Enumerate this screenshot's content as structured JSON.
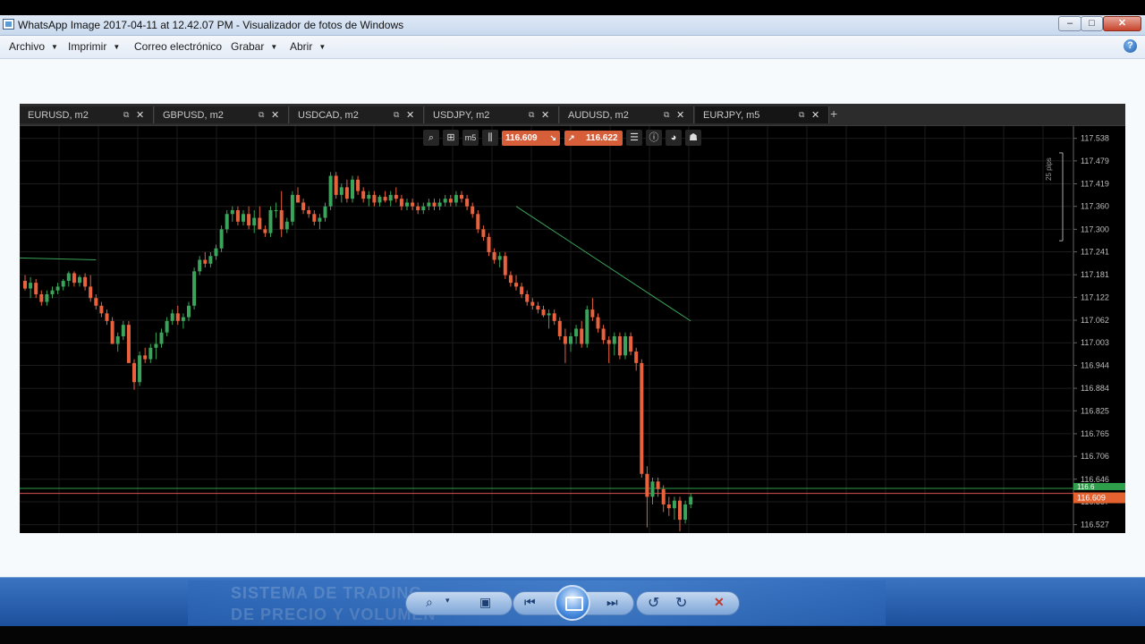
{
  "window": {
    "title": "WhatsApp Image 2017-04-11 at 12.42.07 PM - Visualizador de fotos de Windows",
    "minimize_label": "–",
    "maximize_label": "□",
    "close_label": "✕"
  },
  "menu": {
    "items": [
      {
        "label": "Archivo",
        "has_dropdown": true
      },
      {
        "label": "Imprimir",
        "has_dropdown": true
      },
      {
        "label": "Correo electrónico",
        "has_dropdown": false
      },
      {
        "label": "Grabar",
        "has_dropdown": true
      },
      {
        "label": "Abrir",
        "has_dropdown": true
      }
    ],
    "help_icon": "?"
  },
  "trading_screenshot": {
    "tabs": [
      {
        "label": "EURUSD, m2",
        "active": false
      },
      {
        "label": "GBPUSD, m2",
        "active": false
      },
      {
        "label": "USDCAD, m2",
        "active": false
      },
      {
        "label": "USDJPY, m2",
        "active": false
      },
      {
        "label": "AUDUSD, m2",
        "active": false
      },
      {
        "label": "EURJPY, m5",
        "active": true
      }
    ],
    "add_tab": "+",
    "toolbar": {
      "sell_price": "116.609",
      "buy_price": "116.622",
      "timeframe_label": "m5"
    },
    "pips_label": "25 pips",
    "current_price_label": "116.609",
    "green_tag_label": "116.6",
    "colors": {
      "bull": "#3aa55a",
      "bear": "#e8623e",
      "bid_line": "#d9534f",
      "ask_line": "#2e9e4a"
    }
  },
  "chart_data": {
    "type": "candlestick",
    "symbol": "EURJPY",
    "timeframe": "m5",
    "y_ticks": [
      "117.538",
      "117.479",
      "117.419",
      "117.360",
      "117.300",
      "117.241",
      "117.181",
      "117.122",
      "117.062",
      "117.003",
      "116.944",
      "116.884",
      "116.825",
      "116.765",
      "116.706",
      "116.646",
      "116.587",
      "116.527"
    ],
    "ylim": [
      116.505,
      117.57
    ],
    "bid": 116.609,
    "ask": 116.622,
    "candles": [
      {
        "o": 117.165,
        "h": 117.18,
        "l": 117.14,
        "c": 117.145
      },
      {
        "o": 117.145,
        "h": 117.175,
        "l": 117.12,
        "c": 117.16
      },
      {
        "o": 117.16,
        "h": 117.17,
        "l": 117.12,
        "c": 117.13
      },
      {
        "o": 117.13,
        "h": 117.14,
        "l": 117.1,
        "c": 117.11
      },
      {
        "o": 117.11,
        "h": 117.14,
        "l": 117.1,
        "c": 117.13
      },
      {
        "o": 117.13,
        "h": 117.15,
        "l": 117.12,
        "c": 117.14
      },
      {
        "o": 117.14,
        "h": 117.16,
        "l": 117.13,
        "c": 117.15
      },
      {
        "o": 117.15,
        "h": 117.17,
        "l": 117.14,
        "c": 117.165
      },
      {
        "o": 117.165,
        "h": 117.19,
        "l": 117.15,
        "c": 117.185
      },
      {
        "o": 117.185,
        "h": 117.19,
        "l": 117.15,
        "c": 117.16
      },
      {
        "o": 117.16,
        "h": 117.18,
        "l": 117.15,
        "c": 117.175
      },
      {
        "o": 117.175,
        "h": 117.185,
        "l": 117.14,
        "c": 117.15
      },
      {
        "o": 117.15,
        "h": 117.18,
        "l": 117.11,
        "c": 117.12
      },
      {
        "o": 117.12,
        "h": 117.13,
        "l": 117.09,
        "c": 117.1
      },
      {
        "o": 117.1,
        "h": 117.11,
        "l": 117.07,
        "c": 117.08
      },
      {
        "o": 117.08,
        "h": 117.09,
        "l": 117.05,
        "c": 117.06
      },
      {
        "o": 117.06,
        "h": 117.07,
        "l": 117.0,
        "c": 117.0
      },
      {
        "o": 117.0,
        "h": 117.03,
        "l": 116.98,
        "c": 117.02
      },
      {
        "o": 117.02,
        "h": 117.06,
        "l": 117.01,
        "c": 117.05
      },
      {
        "o": 117.05,
        "h": 117.06,
        "l": 116.96,
        "c": 116.95
      },
      {
        "o": 116.95,
        "h": 116.96,
        "l": 116.88,
        "c": 116.9
      },
      {
        "o": 116.9,
        "h": 116.98,
        "l": 116.89,
        "c": 116.97
      },
      {
        "o": 116.97,
        "h": 116.99,
        "l": 116.95,
        "c": 116.96
      },
      {
        "o": 116.96,
        "h": 117.0,
        "l": 116.95,
        "c": 116.99
      },
      {
        "o": 116.99,
        "h": 117.03,
        "l": 116.96,
        "c": 117.0
      },
      {
        "o": 117.0,
        "h": 117.04,
        "l": 116.99,
        "c": 117.03
      },
      {
        "o": 117.03,
        "h": 117.07,
        "l": 117.02,
        "c": 117.06
      },
      {
        "o": 117.06,
        "h": 117.09,
        "l": 117.05,
        "c": 117.08
      },
      {
        "o": 117.08,
        "h": 117.1,
        "l": 117.05,
        "c": 117.06
      },
      {
        "o": 117.06,
        "h": 117.08,
        "l": 117.04,
        "c": 117.07
      },
      {
        "o": 117.07,
        "h": 117.11,
        "l": 117.06,
        "c": 117.1
      },
      {
        "o": 117.1,
        "h": 117.2,
        "l": 117.09,
        "c": 117.19
      },
      {
        "o": 117.19,
        "h": 117.23,
        "l": 117.18,
        "c": 117.22
      },
      {
        "o": 117.22,
        "h": 117.24,
        "l": 117.2,
        "c": 117.21
      },
      {
        "o": 117.21,
        "h": 117.24,
        "l": 117.2,
        "c": 117.23
      },
      {
        "o": 117.23,
        "h": 117.26,
        "l": 117.22,
        "c": 117.25
      },
      {
        "o": 117.25,
        "h": 117.31,
        "l": 117.24,
        "c": 117.3
      },
      {
        "o": 117.3,
        "h": 117.35,
        "l": 117.29,
        "c": 117.34
      },
      {
        "o": 117.34,
        "h": 117.36,
        "l": 117.32,
        "c": 117.35
      },
      {
        "o": 117.35,
        "h": 117.36,
        "l": 117.31,
        "c": 117.32
      },
      {
        "o": 117.32,
        "h": 117.35,
        "l": 117.31,
        "c": 117.34
      },
      {
        "o": 117.34,
        "h": 117.36,
        "l": 117.3,
        "c": 117.31
      },
      {
        "o": 117.31,
        "h": 117.35,
        "l": 117.29,
        "c": 117.33
      },
      {
        "o": 117.33,
        "h": 117.36,
        "l": 117.3,
        "c": 117.3
      },
      {
        "o": 117.3,
        "h": 117.31,
        "l": 117.28,
        "c": 117.29
      },
      {
        "o": 117.29,
        "h": 117.36,
        "l": 117.28,
        "c": 117.35
      },
      {
        "o": 117.35,
        "h": 117.37,
        "l": 117.33,
        "c": 117.35
      },
      {
        "o": 117.35,
        "h": 117.4,
        "l": 117.28,
        "c": 117.3
      },
      {
        "o": 117.3,
        "h": 117.33,
        "l": 117.29,
        "c": 117.32
      },
      {
        "o": 117.32,
        "h": 117.4,
        "l": 117.31,
        "c": 117.39
      },
      {
        "o": 117.39,
        "h": 117.41,
        "l": 117.37,
        "c": 117.37
      },
      {
        "o": 117.37,
        "h": 117.38,
        "l": 117.34,
        "c": 117.35
      },
      {
        "o": 117.35,
        "h": 117.36,
        "l": 117.33,
        "c": 117.34
      },
      {
        "o": 117.34,
        "h": 117.35,
        "l": 117.31,
        "c": 117.32
      },
      {
        "o": 117.32,
        "h": 117.34,
        "l": 117.3,
        "c": 117.33
      },
      {
        "o": 117.33,
        "h": 117.37,
        "l": 117.32,
        "c": 117.36
      },
      {
        "o": 117.36,
        "h": 117.45,
        "l": 117.35,
        "c": 117.44
      },
      {
        "o": 117.44,
        "h": 117.45,
        "l": 117.38,
        "c": 117.39
      },
      {
        "o": 117.39,
        "h": 117.42,
        "l": 117.37,
        "c": 117.41
      },
      {
        "o": 117.41,
        "h": 117.43,
        "l": 117.37,
        "c": 117.38
      },
      {
        "o": 117.38,
        "h": 117.44,
        "l": 117.37,
        "c": 117.43
      },
      {
        "o": 117.43,
        "h": 117.44,
        "l": 117.39,
        "c": 117.4
      },
      {
        "o": 117.4,
        "h": 117.41,
        "l": 117.37,
        "c": 117.38
      },
      {
        "o": 117.38,
        "h": 117.4,
        "l": 117.36,
        "c": 117.39
      },
      {
        "o": 117.39,
        "h": 117.4,
        "l": 117.36,
        "c": 117.37
      },
      {
        "o": 117.37,
        "h": 117.39,
        "l": 117.36,
        "c": 117.385
      },
      {
        "o": 117.385,
        "h": 117.4,
        "l": 117.37,
        "c": 117.375
      },
      {
        "o": 117.375,
        "h": 117.4,
        "l": 117.36,
        "c": 117.39
      },
      {
        "o": 117.39,
        "h": 117.41,
        "l": 117.37,
        "c": 117.38
      },
      {
        "o": 117.38,
        "h": 117.39,
        "l": 117.35,
        "c": 117.36
      },
      {
        "o": 117.36,
        "h": 117.38,
        "l": 117.35,
        "c": 117.37
      },
      {
        "o": 117.37,
        "h": 117.38,
        "l": 117.35,
        "c": 117.36
      },
      {
        "o": 117.36,
        "h": 117.37,
        "l": 117.34,
        "c": 117.35
      },
      {
        "o": 117.35,
        "h": 117.37,
        "l": 117.34,
        "c": 117.36
      },
      {
        "o": 117.36,
        "h": 117.38,
        "l": 117.35,
        "c": 117.37
      },
      {
        "o": 117.37,
        "h": 117.38,
        "l": 117.35,
        "c": 117.36
      },
      {
        "o": 117.36,
        "h": 117.38,
        "l": 117.35,
        "c": 117.37
      },
      {
        "o": 117.37,
        "h": 117.39,
        "l": 117.36,
        "c": 117.38
      },
      {
        "o": 117.38,
        "h": 117.39,
        "l": 117.36,
        "c": 117.37
      },
      {
        "o": 117.37,
        "h": 117.4,
        "l": 117.36,
        "c": 117.39
      },
      {
        "o": 117.39,
        "h": 117.4,
        "l": 117.37,
        "c": 117.38
      },
      {
        "o": 117.38,
        "h": 117.39,
        "l": 117.35,
        "c": 117.36
      },
      {
        "o": 117.36,
        "h": 117.37,
        "l": 117.33,
        "c": 117.34
      },
      {
        "o": 117.34,
        "h": 117.35,
        "l": 117.29,
        "c": 117.3
      },
      {
        "o": 117.3,
        "h": 117.31,
        "l": 117.27,
        "c": 117.28
      },
      {
        "o": 117.28,
        "h": 117.29,
        "l": 117.23,
        "c": 117.24
      },
      {
        "o": 117.24,
        "h": 117.25,
        "l": 117.21,
        "c": 117.22
      },
      {
        "o": 117.22,
        "h": 117.24,
        "l": 117.2,
        "c": 117.23
      },
      {
        "o": 117.23,
        "h": 117.24,
        "l": 117.17,
        "c": 117.18
      },
      {
        "o": 117.18,
        "h": 117.19,
        "l": 117.15,
        "c": 117.16
      },
      {
        "o": 117.16,
        "h": 117.18,
        "l": 117.14,
        "c": 117.15
      },
      {
        "o": 117.15,
        "h": 117.16,
        "l": 117.12,
        "c": 117.13
      },
      {
        "o": 117.13,
        "h": 117.14,
        "l": 117.1,
        "c": 117.11
      },
      {
        "o": 117.11,
        "h": 117.12,
        "l": 117.09,
        "c": 117.1
      },
      {
        "o": 117.1,
        "h": 117.11,
        "l": 117.08,
        "c": 117.09
      },
      {
        "o": 117.09,
        "h": 117.1,
        "l": 117.07,
        "c": 117.075
      },
      {
        "o": 117.075,
        "h": 117.09,
        "l": 117.04,
        "c": 117.08
      },
      {
        "o": 117.08,
        "h": 117.09,
        "l": 117.05,
        "c": 117.06
      },
      {
        "o": 117.06,
        "h": 117.07,
        "l": 117.01,
        "c": 117.02
      },
      {
        "o": 117.02,
        "h": 117.04,
        "l": 116.95,
        "c": 117.0
      },
      {
        "o": 117.0,
        "h": 117.03,
        "l": 116.98,
        "c": 117.02
      },
      {
        "o": 117.02,
        "h": 117.05,
        "l": 117.0,
        "c": 117.04
      },
      {
        "o": 117.04,
        "h": 117.06,
        "l": 116.99,
        "c": 117.0
      },
      {
        "o": 117.0,
        "h": 117.1,
        "l": 116.99,
        "c": 117.09
      },
      {
        "o": 117.09,
        "h": 117.12,
        "l": 117.06,
        "c": 117.07
      },
      {
        "o": 117.07,
        "h": 117.08,
        "l": 117.03,
        "c": 117.04
      },
      {
        "o": 117.04,
        "h": 117.05,
        "l": 117.0,
        "c": 117.01
      },
      {
        "o": 117.01,
        "h": 117.02,
        "l": 116.95,
        "c": 117.0
      },
      {
        "o": 117.0,
        "h": 117.03,
        "l": 116.97,
        "c": 117.02
      },
      {
        "o": 117.02,
        "h": 117.03,
        "l": 116.96,
        "c": 116.97
      },
      {
        "o": 116.97,
        "h": 117.03,
        "l": 116.96,
        "c": 117.02
      },
      {
        "o": 117.02,
        "h": 117.03,
        "l": 116.97,
        "c": 116.98
      },
      {
        "o": 116.98,
        "h": 116.99,
        "l": 116.93,
        "c": 116.95
      },
      {
        "o": 116.95,
        "h": 116.96,
        "l": 116.65,
        "c": 116.66
      },
      {
        "o": 116.66,
        "h": 116.68,
        "l": 116.52,
        "c": 116.6
      },
      {
        "o": 116.6,
        "h": 116.65,
        "l": 116.58,
        "c": 116.64
      },
      {
        "o": 116.64,
        "h": 116.65,
        "l": 116.6,
        "c": 116.62
      },
      {
        "o": 116.62,
        "h": 116.63,
        "l": 116.56,
        "c": 116.58
      },
      {
        "o": 116.58,
        "h": 116.6,
        "l": 116.55,
        "c": 116.57
      },
      {
        "o": 116.57,
        "h": 116.6,
        "l": 116.54,
        "c": 116.59
      },
      {
        "o": 116.59,
        "h": 116.6,
        "l": 116.51,
        "c": 116.54
      },
      {
        "o": 116.54,
        "h": 116.59,
        "l": 116.53,
        "c": 116.58
      },
      {
        "o": 116.58,
        "h": 116.61,
        "l": 116.57,
        "c": 116.6
      }
    ]
  },
  "control_bar": {
    "background_text_1": "SISTEMA DE TRADING",
    "background_text_2": "DE PRECIO Y VOLUMEN",
    "zoom_icon": "⌕",
    "fit_icon": "▣",
    "prev_icon": "⏮",
    "next_icon": "⏭",
    "rotate_ccw_icon": "↺",
    "rotate_cw_icon": "↻",
    "delete_icon": "✕"
  }
}
